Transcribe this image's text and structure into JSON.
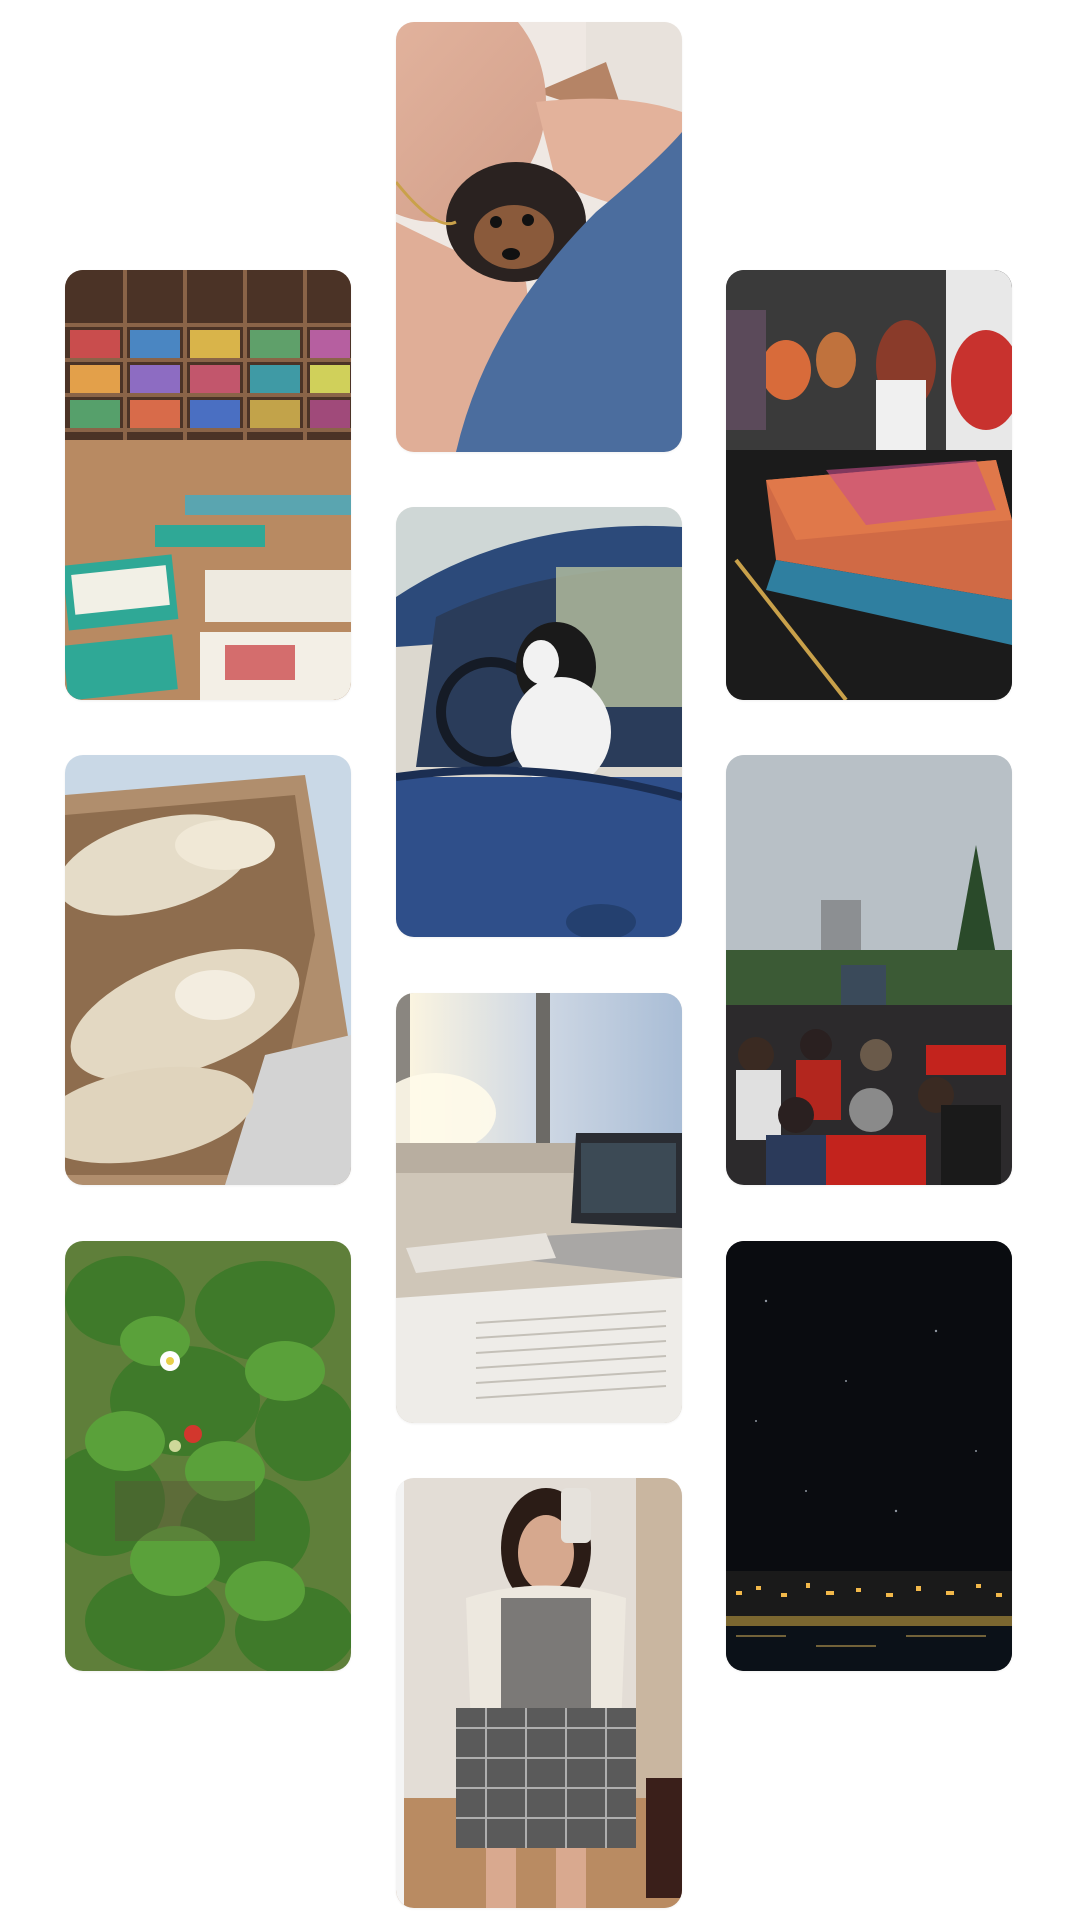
{
  "gallery": {
    "photos": [
      {
        "id": "portrait-with-dog",
        "icon": "photo-icon"
      },
      {
        "id": "bookstore-shelves",
        "icon": "photo-icon"
      },
      {
        "id": "book-event-reading",
        "icon": "photo-icon"
      },
      {
        "id": "dog-in-car",
        "icon": "photo-icon"
      },
      {
        "id": "bread-bagels",
        "icon": "photo-icon"
      },
      {
        "id": "crowd-at-concert",
        "icon": "photo-icon"
      },
      {
        "id": "desk-by-window",
        "icon": "photo-icon"
      },
      {
        "id": "strawberry-plants",
        "icon": "photo-icon"
      },
      {
        "id": "night-city-sky",
        "icon": "photo-icon"
      },
      {
        "id": "mirror-selfie",
        "icon": "photo-icon"
      }
    ]
  }
}
